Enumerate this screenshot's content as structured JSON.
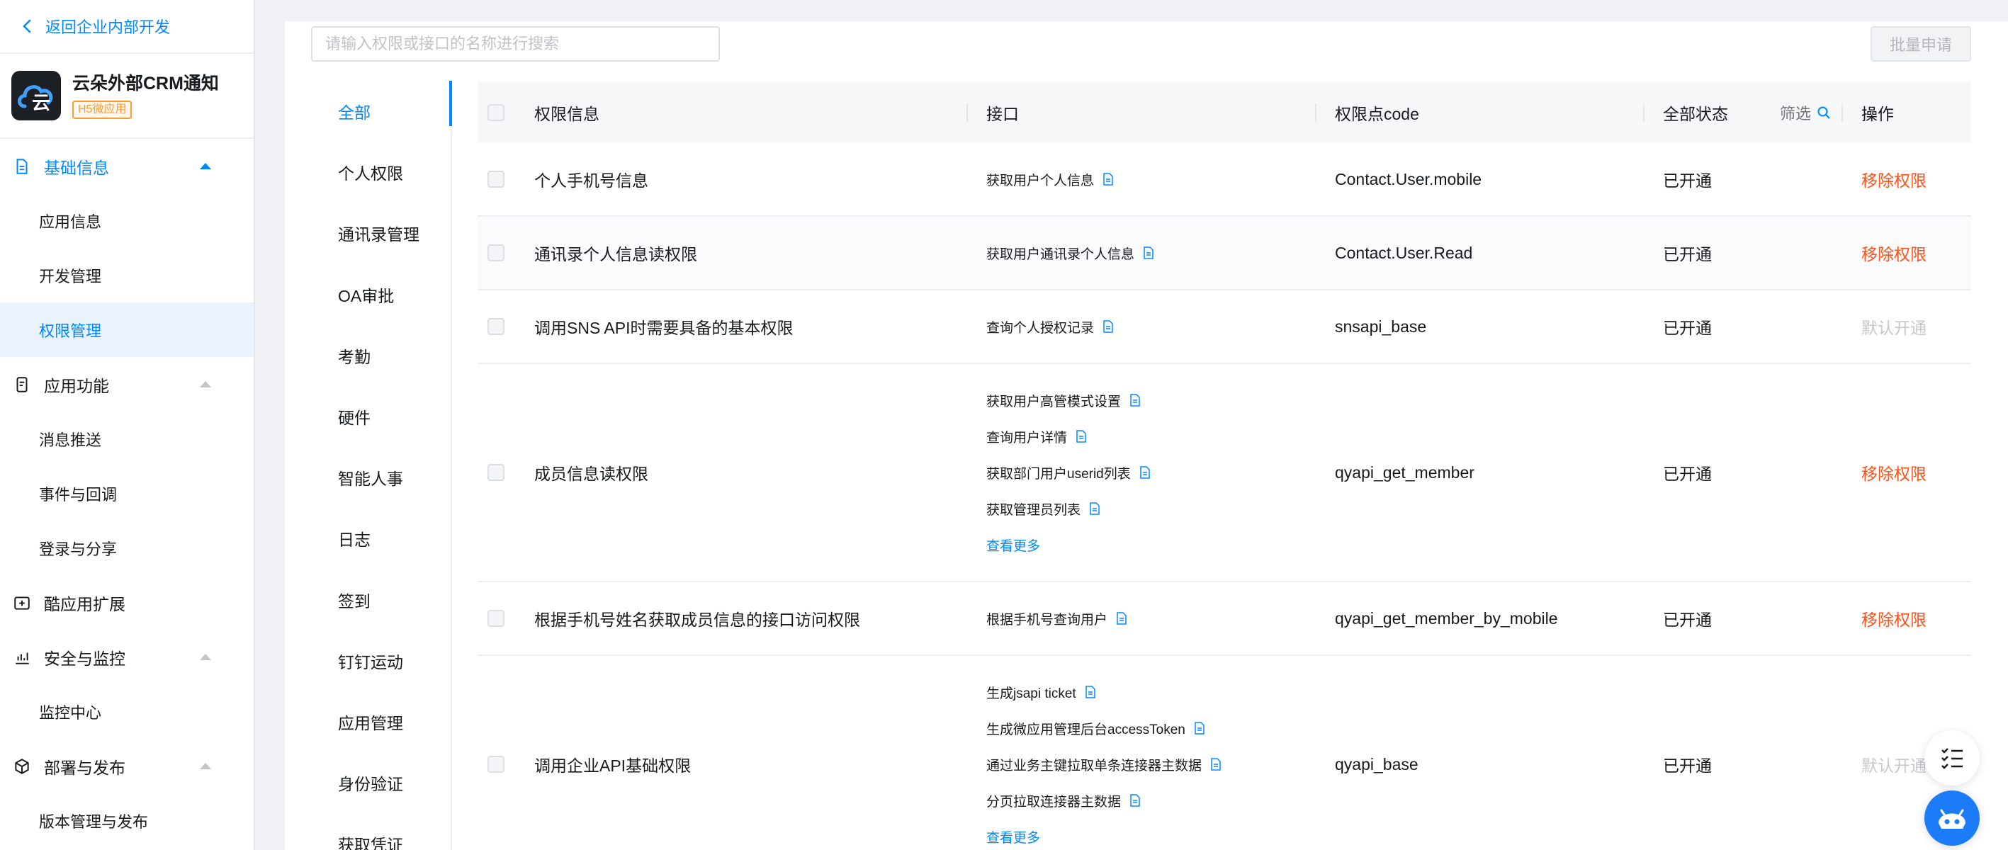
{
  "sidebar": {
    "back_label": "返回企业内部开发",
    "app_name": "云朵外部CRM通知",
    "app_badge": "H5微应用",
    "groups": [
      {
        "label": "基础信息",
        "items": [
          "应用信息",
          "开发管理",
          "权限管理"
        ]
      },
      {
        "label": "应用功能",
        "items": [
          "消息推送",
          "事件与回调",
          "登录与分享"
        ]
      },
      {
        "label": "酷应用扩展",
        "items": []
      },
      {
        "label": "安全与监控",
        "items": [
          "监控中心"
        ]
      },
      {
        "label": "部署与发布",
        "items": [
          "版本管理与发布"
        ]
      }
    ],
    "selected_item": "权限管理",
    "app_logo_text": "云"
  },
  "main": {
    "search_placeholder": "请输入权限或接口的名称进行搜索",
    "batch_button": "批量申请",
    "categories": [
      "全部",
      "个人权限",
      "通讯录管理",
      "OA审批",
      "考勤",
      "硬件",
      "智能人事",
      "日志",
      "签到",
      "钉钉运动",
      "应用管理",
      "身份验证",
      "获取凭证"
    ],
    "active_category": "全部",
    "table": {
      "headers": {
        "perm": "权限信息",
        "api": "接口",
        "code": "权限点code",
        "status": "全部状态",
        "filter": "筛选",
        "op": "操作"
      },
      "rows": [
        {
          "perm": "个人手机号信息",
          "apis": [
            "获取用户个人信息"
          ],
          "more": "",
          "code": "Contact.User.mobile",
          "status": "已开通",
          "op": "移除权限",
          "op_type": "remove"
        },
        {
          "perm": "通讯录个人信息读权限",
          "apis": [
            "获取用户通讯录个人信息"
          ],
          "more": "",
          "code": "Contact.User.Read",
          "status": "已开通",
          "op": "移除权限",
          "op_type": "remove"
        },
        {
          "perm": "调用SNS API时需要具备的基本权限",
          "apis": [
            "查询个人授权记录"
          ],
          "more": "",
          "code": "snsapi_base",
          "status": "已开通",
          "op": "默认开通",
          "op_type": "default"
        },
        {
          "perm": "成员信息读权限",
          "apis": [
            "获取用户高管模式设置",
            "查询用户详情",
            "获取部门用户userid列表",
            "获取管理员列表"
          ],
          "more": "查看更多",
          "code": "qyapi_get_member",
          "status": "已开通",
          "op": "移除权限",
          "op_type": "remove"
        },
        {
          "perm": "根据手机号姓名获取成员信息的接口访问权限",
          "apis": [
            "根据手机号查询用户"
          ],
          "more": "",
          "code": "qyapi_get_member_by_mobile",
          "status": "已开通",
          "op": "移除权限",
          "op_type": "remove"
        },
        {
          "perm": "调用企业API基础权限",
          "apis": [
            "生成jsapi ticket",
            "生成微应用管理后台accessToken",
            "通过业务主键拉取单条连接器主数据",
            "分页拉取连接器主数据"
          ],
          "more": "查看更多",
          "code": "qyapi_base",
          "status": "已开通",
          "op": "默认开通",
          "op_type": "default"
        }
      ]
    }
  },
  "colors": {
    "accent": "#0089ff",
    "danger": "#ff5219",
    "badge": "#ff9b2b",
    "muted": "#c4c7cc"
  },
  "icons": {
    "back": "chevron-left-icon",
    "doc": "document-icon",
    "search": "search-icon",
    "fab_list": "task-list-icon",
    "fab_bot": "assistant-bot-icon"
  }
}
